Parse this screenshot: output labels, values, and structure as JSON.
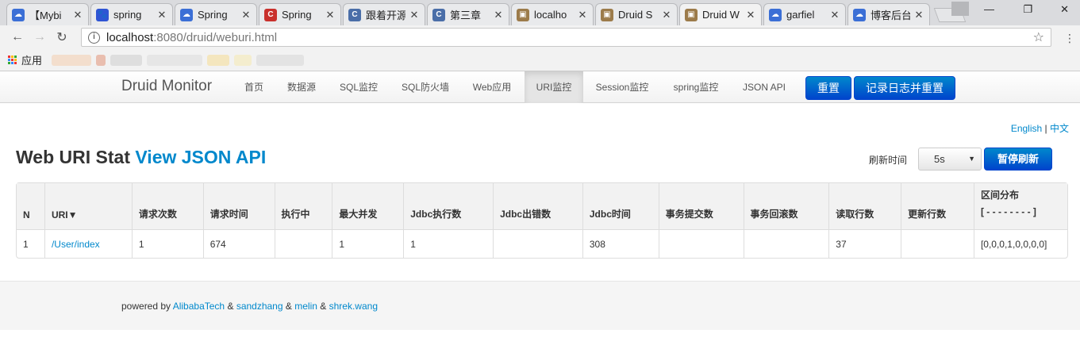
{
  "browser": {
    "tabs": [
      {
        "title": "【Mybi",
        "icon": "cloud-icon",
        "color": "#3b6fd6",
        "glyph": "☁"
      },
      {
        "title": "spring ",
        "icon": "paw-icon",
        "color": "#2f55d4",
        "glyph": "🐾"
      },
      {
        "title": "Spring ",
        "icon": "cloud-icon",
        "color": "#3b6fd6",
        "glyph": "☁"
      },
      {
        "title": "Spring ",
        "icon": "csdn-icon",
        "color": "#c9302c",
        "glyph": "C"
      },
      {
        "title": "跟着开源",
        "icon": "c-icon",
        "color": "#4a6ea8",
        "glyph": "C"
      },
      {
        "title": "第三章 ",
        "icon": "c-icon",
        "color": "#4a6ea8",
        "glyph": "C"
      },
      {
        "title": "localho",
        "icon": "image-icon",
        "color": "#9c7b4a",
        "glyph": "▣"
      },
      {
        "title": "Druid S",
        "icon": "image-icon",
        "color": "#9c7b4a",
        "glyph": "▣"
      },
      {
        "title": "Druid W",
        "icon": "image-icon",
        "color": "#9c7b4a",
        "glyph": "▣",
        "active": true
      },
      {
        "title": "garfiel",
        "icon": "cloud-icon",
        "color": "#3b6fd6",
        "glyph": "☁"
      },
      {
        "title": "博客后台",
        "icon": "cloud-icon",
        "color": "#3b6fd6",
        "glyph": "☁"
      }
    ],
    "close_glyph": "✕",
    "url_host": "localhost",
    "url_path": ":8080/druid/weburi.html",
    "bookmarks_label": "应用"
  },
  "nav": {
    "brand": "Druid Monitor",
    "items": [
      "首页",
      "数据源",
      "SQL监控",
      "SQL防火墙",
      "Web应用",
      "URI监控",
      "Session监控",
      "spring监控",
      "JSON API"
    ],
    "active": "URI监控",
    "reset": "重置",
    "log_reset": "记录日志并重置"
  },
  "lang": {
    "english": "English",
    "sep": "|",
    "chinese": "中文"
  },
  "page": {
    "title": "Web URI Stat",
    "json_link": "View JSON API",
    "refresh_label": "刷新时间",
    "refresh_value": "5s",
    "pause_button": "暂停刷新"
  },
  "table": {
    "headers": [
      "N",
      "URI▼",
      "请求次数",
      "请求时间",
      "执行中",
      "最大并发",
      "Jdbc执行数",
      "Jdbc出错数",
      "Jdbc时间",
      "事务提交数",
      "事务回滚数",
      "读取行数",
      "更新行数"
    ],
    "dist_header": "区间分布",
    "dist_sub": "[ - - - - - - - - ]",
    "rows": [
      [
        "1",
        "/User/index",
        "1",
        "674",
        "",
        "1",
        "1",
        "",
        "308",
        "",
        "",
        "37",
        "",
        "[0,0,0,1,0,0,0,0]"
      ]
    ]
  },
  "footer": {
    "prefix": "powered by",
    "amp": "&",
    "links": [
      "AlibabaTech",
      "sandzhang",
      "melin",
      "shrek.wang"
    ]
  }
}
